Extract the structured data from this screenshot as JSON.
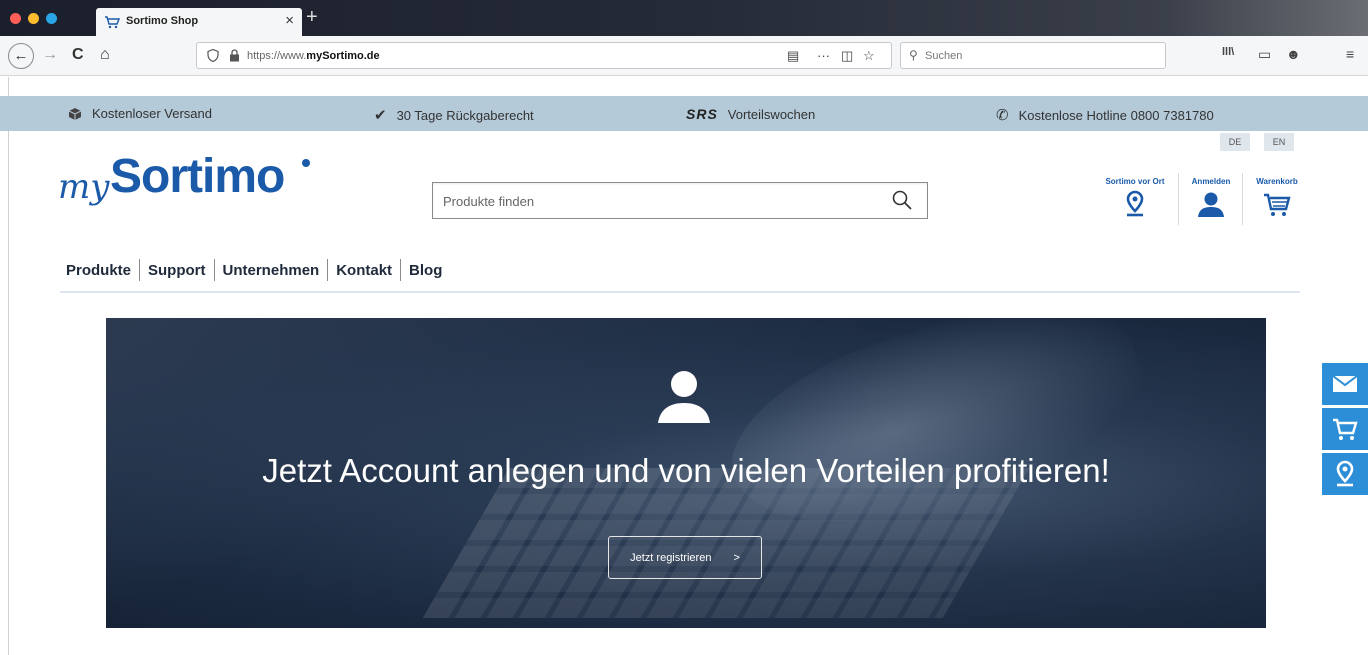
{
  "browser": {
    "tab_title": "Sortimo Shop",
    "tab_close": "×",
    "new_tab": "+",
    "url_prefix": "https://www.",
    "url_domain": "mySortimo.de",
    "search_placeholder": "Suchen",
    "back": "←",
    "forward": "→",
    "reload": "C",
    "home": "⌂",
    "more_actions": "···",
    "bookmark_star": "☆",
    "library": "lll\\",
    "sidebar": "▭",
    "account": "☻",
    "menu": "≡"
  },
  "usp_bar": {
    "shipping": "Kostenloser Versand",
    "returns": "30 Tage Rückgaberecht",
    "srs_logo": "SRS",
    "promo": "Vorteilswochen",
    "hotline": "Kostenlose Hotline 0800 7381780"
  },
  "languages": [
    "DE",
    "EN"
  ],
  "logo": {
    "prefix": "my",
    "name": "Sortimo"
  },
  "product_search": {
    "placeholder": "Produkte finden"
  },
  "header_links": {
    "store_locator": "Sortimo vor Ort",
    "login": "Anmelden",
    "cart": "Warenkorb"
  },
  "main_nav": [
    "Produkte",
    "Support",
    "Unternehmen",
    "Kontakt",
    "Blog"
  ],
  "hero": {
    "title": "Jetzt Account anlegen und von vielen Vorteilen profitieren!",
    "button_label": "Jetzt registrieren",
    "button_arrow": ">"
  },
  "side_tabs": [
    "mail-icon",
    "cart-icon",
    "location-pin-icon"
  ],
  "colors": {
    "brand_blue": "#1a5aa8",
    "usp_bar": "#b4cad9",
    "side_tab": "#2d8ed8",
    "hero_dark": "#1b2a40"
  }
}
